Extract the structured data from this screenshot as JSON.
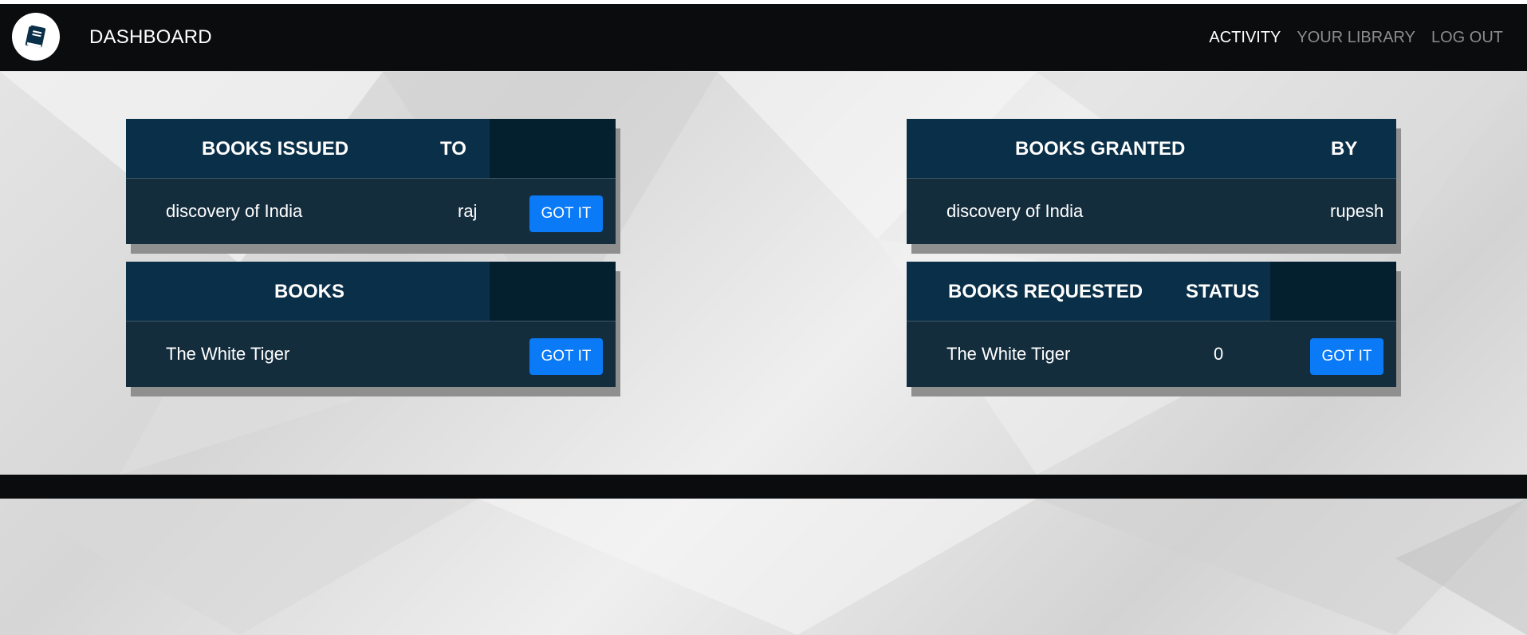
{
  "navbar": {
    "brand": "DASHBOARD",
    "logo_icon": "book-icon",
    "links": [
      {
        "label": "ACTIVITY",
        "active": true
      },
      {
        "label": "YOUR LIBRARY",
        "active": false
      },
      {
        "label": "LOG OUT",
        "active": false
      }
    ]
  },
  "issued": {
    "header": {
      "col1": "BOOKS ISSUED",
      "col2": "TO"
    },
    "row": {
      "book": "discovery of India",
      "to": "raj",
      "button": "GOT IT"
    }
  },
  "granted": {
    "header": {
      "col1": "BOOKS GRANTED",
      "col2": "BY"
    },
    "row": {
      "book": "discovery of India",
      "by": "rupesh"
    }
  },
  "books": {
    "header": {
      "col1": "BOOKS"
    },
    "row": {
      "book": "The White Tiger",
      "button": "GOT IT"
    }
  },
  "requested": {
    "header": {
      "col1": "BOOKS REQUESTED",
      "col2": "STATUS"
    },
    "row": {
      "book": "The White Tiger",
      "status": "0",
      "button": "GOT IT"
    }
  },
  "colors": {
    "navbar": "#0b0c0e",
    "card_header": "#0a2f48",
    "card_body": "#142d3d",
    "button": "#0a7af6"
  }
}
